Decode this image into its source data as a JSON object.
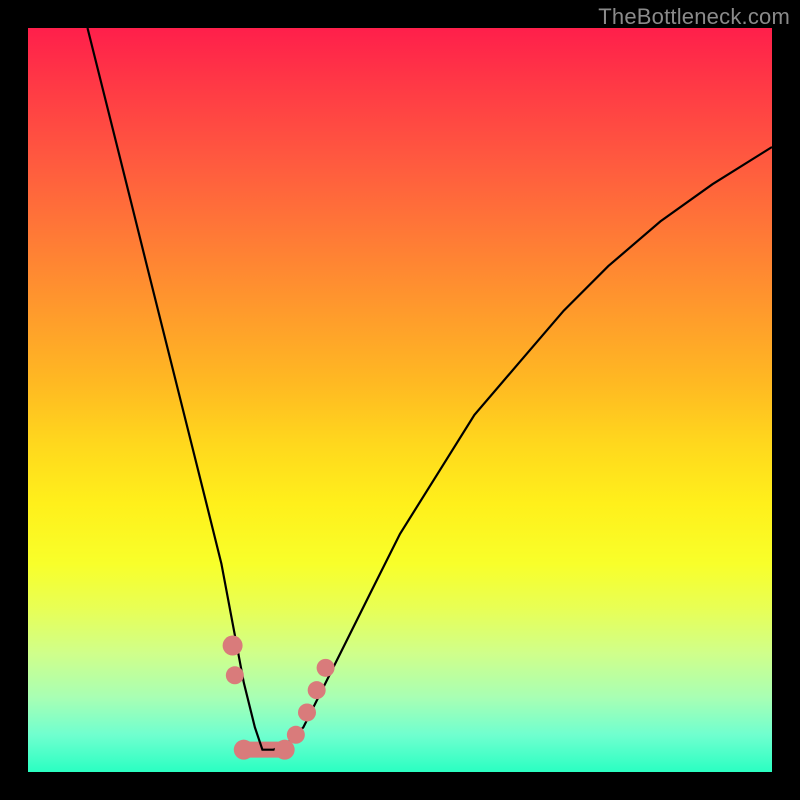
{
  "watermark": {
    "text": "TheBottleneck.com"
  },
  "chart_data": {
    "type": "line",
    "title": "",
    "xlabel": "",
    "ylabel": "",
    "xlim": [
      0,
      100
    ],
    "ylim": [
      0,
      100
    ],
    "grid": false,
    "legend": false,
    "series": [
      {
        "name": "v-curve",
        "stroke": "#000000",
        "x": [
          8,
          10,
          12,
          14,
          16,
          18,
          20,
          22,
          24,
          26,
          27.5,
          29,
          30.5,
          31.5,
          33,
          35,
          37,
          39,
          42,
          46,
          50,
          55,
          60,
          66,
          72,
          78,
          85,
          92,
          100
        ],
        "y": [
          100,
          92,
          84,
          76,
          68,
          60,
          52,
          44,
          36,
          28,
          20,
          12,
          6,
          3,
          3,
          4,
          6,
          10,
          16,
          24,
          32,
          40,
          48,
          55,
          62,
          68,
          74,
          79,
          84
        ]
      }
    ],
    "markers": [
      {
        "name": "left-dot-upper",
        "x": 27.5,
        "y": 17,
        "color": "#d97b7b",
        "r": 10
      },
      {
        "name": "left-dot-lower",
        "x": 27.8,
        "y": 13,
        "color": "#d97b7b",
        "r": 9
      },
      {
        "name": "valley-left-end",
        "x": 29.0,
        "y": 3.0,
        "color": "#d97b7b",
        "r": 10
      },
      {
        "name": "valley-right-end",
        "x": 34.5,
        "y": 3.0,
        "color": "#d97b7b",
        "r": 10
      },
      {
        "name": "right-rise-1",
        "x": 36.0,
        "y": 5.0,
        "color": "#d97b7b",
        "r": 9
      },
      {
        "name": "right-rise-2",
        "x": 37.5,
        "y": 8.0,
        "color": "#d97b7b",
        "r": 9
      },
      {
        "name": "right-rise-3",
        "x": 38.8,
        "y": 11.0,
        "color": "#d97b7b",
        "r": 9
      },
      {
        "name": "right-rise-4",
        "x": 40.0,
        "y": 14.0,
        "color": "#d97b7b",
        "r": 9
      }
    ],
    "valley_segment": {
      "name": "valley-bar",
      "x1": 29.0,
      "x2": 34.5,
      "y": 3.0,
      "color": "#d97b7b",
      "thickness": 16
    }
  }
}
